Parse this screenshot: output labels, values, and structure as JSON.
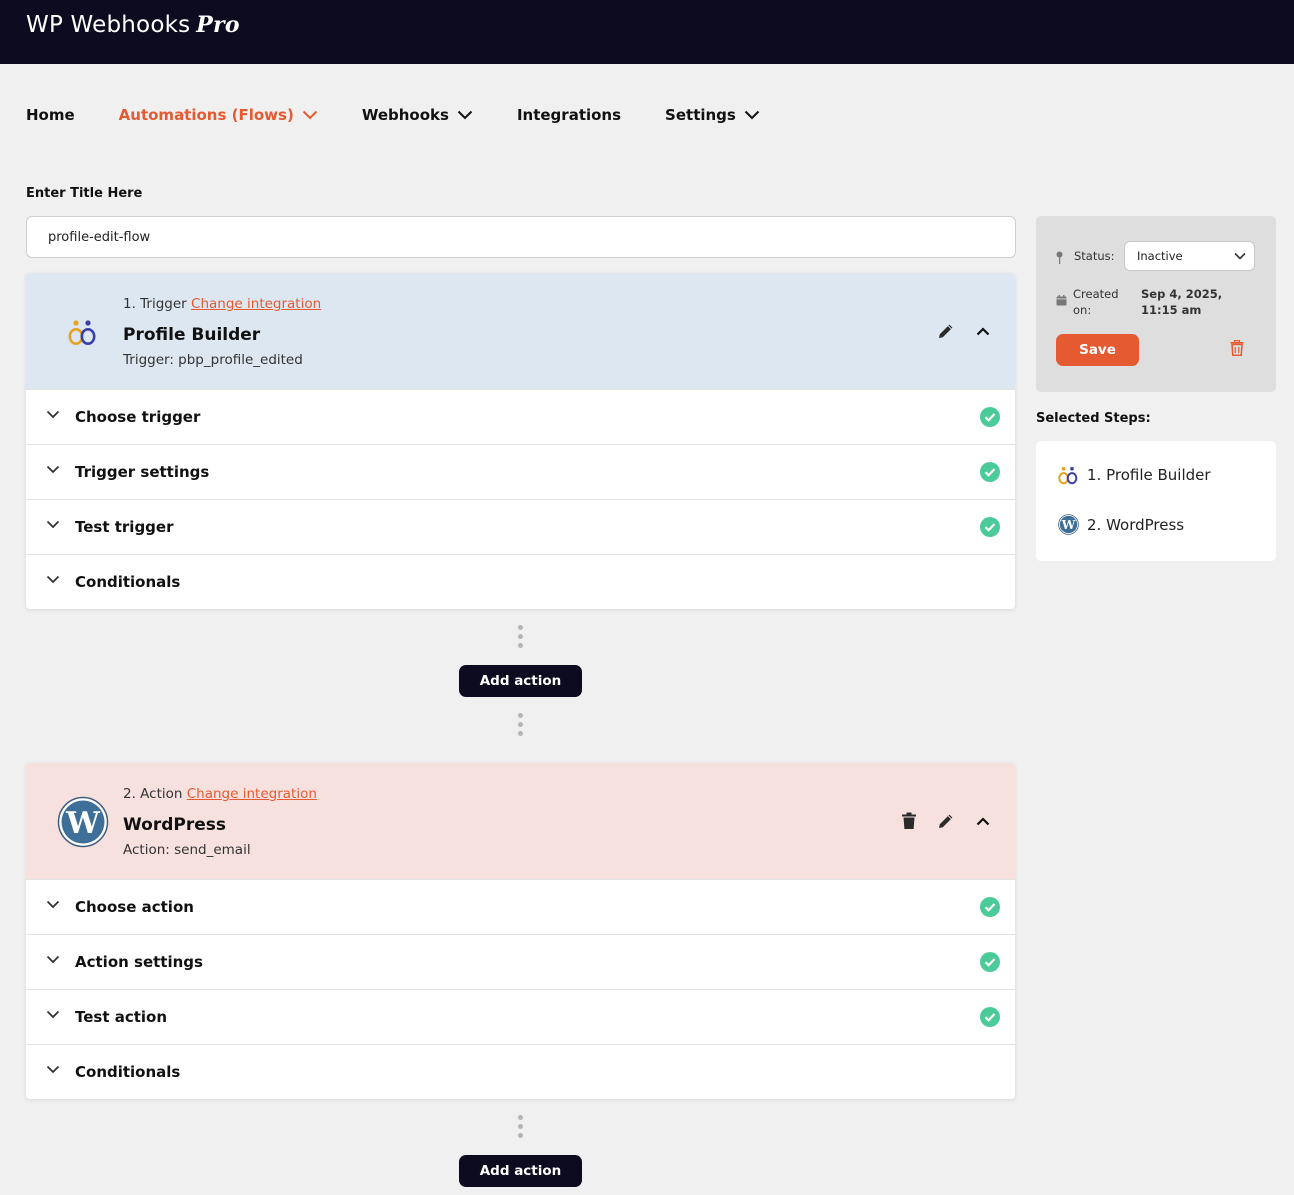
{
  "app": {
    "logo_text": "WP Webhooks",
    "logo_badge": "Pro"
  },
  "nav": {
    "items": [
      {
        "label": "Home"
      },
      {
        "label": "Automations (Flows)"
      },
      {
        "label": "Webhooks"
      },
      {
        "label": "Integrations"
      },
      {
        "label": "Settings"
      }
    ],
    "active_index": 1
  },
  "title_field": {
    "label": "Enter Title Here",
    "value": "profile-edit-flow"
  },
  "steps": [
    {
      "step_text": "1. Trigger",
      "change_link": "Change integration",
      "name": "Profile Builder",
      "subtitle": "Trigger: pbp_profile_edited",
      "icon": "profile-builder-logo",
      "sections": [
        {
          "label": "Choose trigger",
          "complete": true
        },
        {
          "label": "Trigger settings",
          "complete": true
        },
        {
          "label": "Test trigger",
          "complete": true
        },
        {
          "label": "Conditionals",
          "complete": false
        }
      ]
    },
    {
      "step_text": "2. Action",
      "change_link": "Change integration",
      "name": "WordPress",
      "subtitle": "Action: send_email",
      "icon": "wordpress-logo",
      "sections": [
        {
          "label": "Choose action",
          "complete": true
        },
        {
          "label": "Action settings",
          "complete": true
        },
        {
          "label": "Test action",
          "complete": true
        },
        {
          "label": "Conditionals",
          "complete": false
        }
      ]
    }
  ],
  "add_action_label": "Add action",
  "sidebar": {
    "status_label": "Status:",
    "status_value": "Inactive",
    "created_label": "Created on:",
    "created_value": "Sep 4, 2025, 11:15 am",
    "save_label": "Save",
    "selected_steps_label": "Selected Steps:",
    "selected_steps": [
      "1. Profile Builder",
      "2. WordPress"
    ]
  },
  "colors": {
    "accent": "#e55a31",
    "dark": "#0d0b1f",
    "trigger_bg": "#dce7f1",
    "action_bg": "#f7e1df",
    "check": "#4ccb9a"
  }
}
